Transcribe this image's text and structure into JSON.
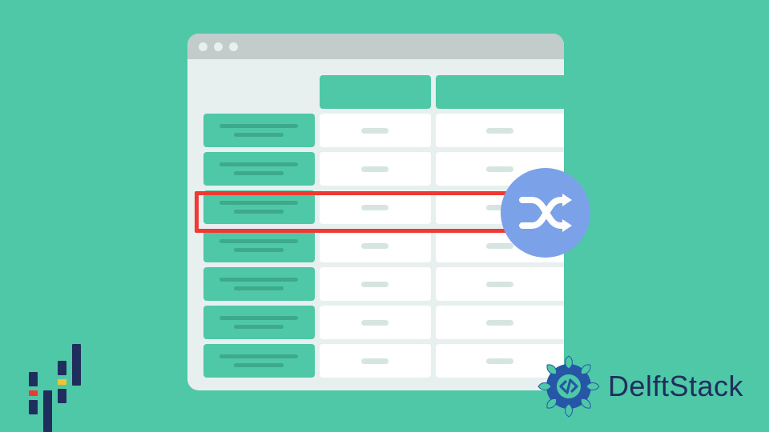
{
  "brand": {
    "name": "DelftStack"
  },
  "icons": {
    "shuffle": "shuffle-icon",
    "code": "code-icon"
  },
  "colors": {
    "accent": "#4ec8a6",
    "highlight": "#ef3a34",
    "badge": "#7ba1e8",
    "brand_dark": "#1f2e5c"
  }
}
